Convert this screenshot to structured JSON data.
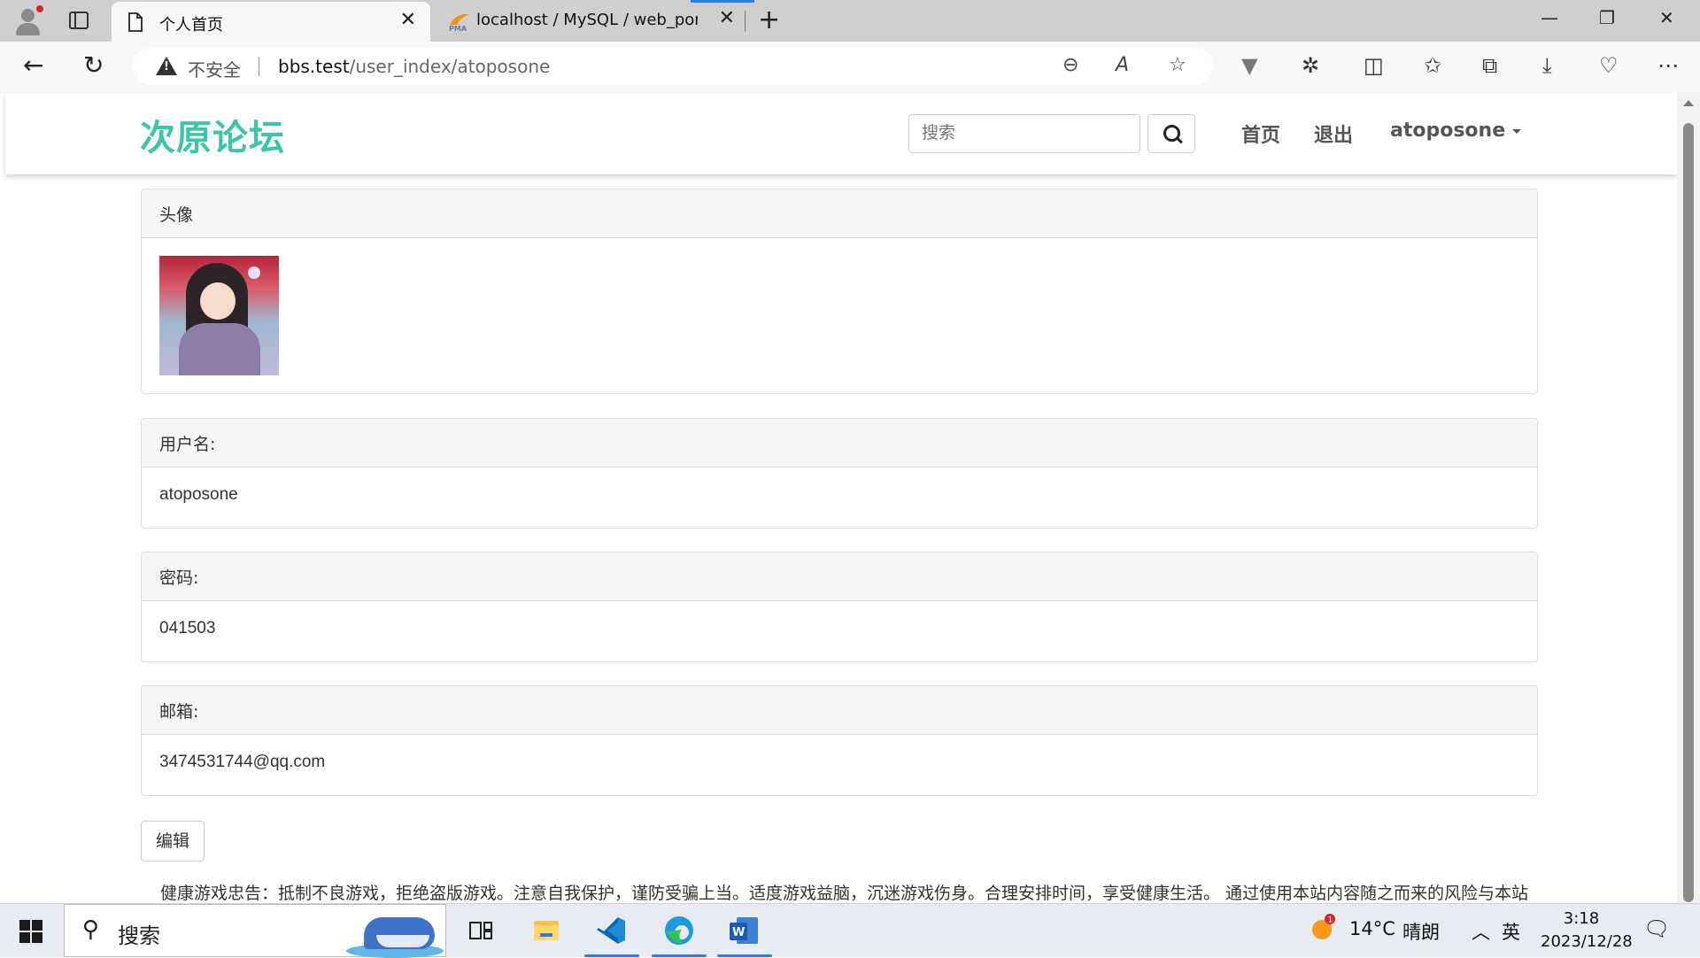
{
  "browser": {
    "tabs": [
      {
        "title": "个人首页",
        "active": true
      },
      {
        "title": "localhost / MySQL / web_portal /",
        "active": false,
        "icon_text": "PMA"
      }
    ],
    "address": {
      "security_label": "不安全",
      "url_host": "bbs.test",
      "url_path": "/user_index/atoposone"
    }
  },
  "site": {
    "brand": "次原论坛",
    "search_placeholder": "搜索",
    "nav": {
      "home": "首页",
      "logout": "退出",
      "user": "atoposone"
    }
  },
  "profile": {
    "avatar_heading": "头像",
    "username_heading": "用户名:",
    "username_value": "atoposone",
    "password_heading": "密码:",
    "password_value": "041503",
    "email_heading": "邮箱:",
    "email_value": "3474531744@qq.com",
    "edit_label": "编辑"
  },
  "footer_note": "健康游戏忠告：抵制不良游戏，拒绝盗版游戏。注意自我保护，谨防受骗上当。适度游戏益脑，沉迷游戏伤身。合理安排时间，享受健康生活。 通过使用本站内容随之而来的风险与本站",
  "taskbar": {
    "search_label": "搜索",
    "weather_badge": "1",
    "temperature": "14°C",
    "weather": "晴朗",
    "ime": "英",
    "time": "3:18",
    "date": "2023/12/28"
  },
  "colors": {
    "brand": "#3cc5a8",
    "panel_heading_bg": "#f5f5f5",
    "tab_strip": "#cfcfcf",
    "taskbar": "#e8ecf2"
  }
}
